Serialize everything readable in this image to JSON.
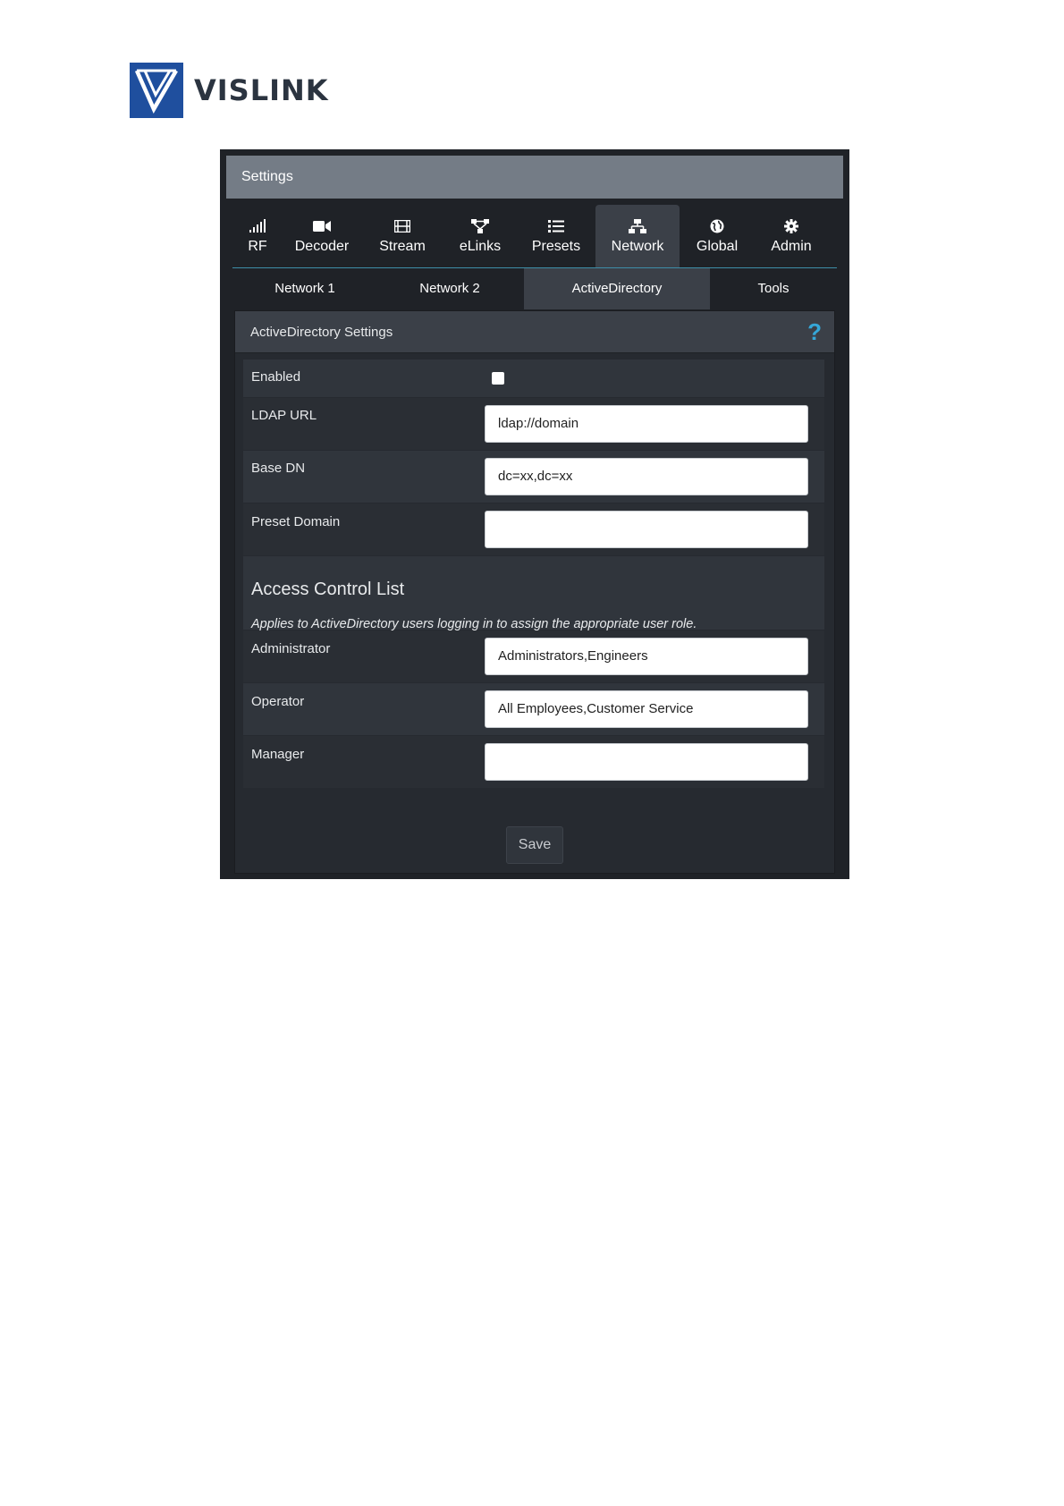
{
  "brand": {
    "name": "VISLINK",
    "color": "#1f4f9e"
  },
  "window": {
    "title": "Settings"
  },
  "tabs": [
    {
      "label": "RF",
      "icon": "signal-bars-icon"
    },
    {
      "label": "Decoder",
      "icon": "video-camera-icon"
    },
    {
      "label": "Stream",
      "icon": "film-icon"
    },
    {
      "label": "eLinks",
      "icon": "sitemap-icon"
    },
    {
      "label": "Presets",
      "icon": "list-icon"
    },
    {
      "label": "Network",
      "icon": "network-icon",
      "active": true
    },
    {
      "label": "Global",
      "icon": "globe-icon"
    },
    {
      "label": "Admin",
      "icon": "gear-icon"
    }
  ],
  "subtabs": [
    {
      "label": "Network 1"
    },
    {
      "label": "Network 2"
    },
    {
      "label": "ActiveDirectory",
      "active": true
    },
    {
      "label": "Tools"
    }
  ],
  "panel": {
    "title": "ActiveDirectory Settings",
    "help_symbol": "?",
    "enabled": {
      "label": "Enabled",
      "checked": false
    },
    "ldap_url": {
      "label": "LDAP URL",
      "value": "ldap://domain"
    },
    "base_dn": {
      "label": "Base DN",
      "value": "dc=xx,dc=xx"
    },
    "preset_domain": {
      "label": "Preset Domain",
      "value": ""
    },
    "acl": {
      "title": "Access Control List",
      "description": "Applies to ActiveDirectory users logging in to assign the appropriate user role.",
      "administrator": {
        "label": "Administrator",
        "value": "Administrators,Engineers"
      },
      "operator": {
        "label": "Operator",
        "value": "All Employees,Customer Service"
      },
      "manager": {
        "label": "Manager",
        "value": ""
      }
    },
    "save_label": "Save"
  },
  "colors": {
    "accent": "#35a7d8",
    "header_bg": "#747c86",
    "panel_bg": "#262a30"
  }
}
